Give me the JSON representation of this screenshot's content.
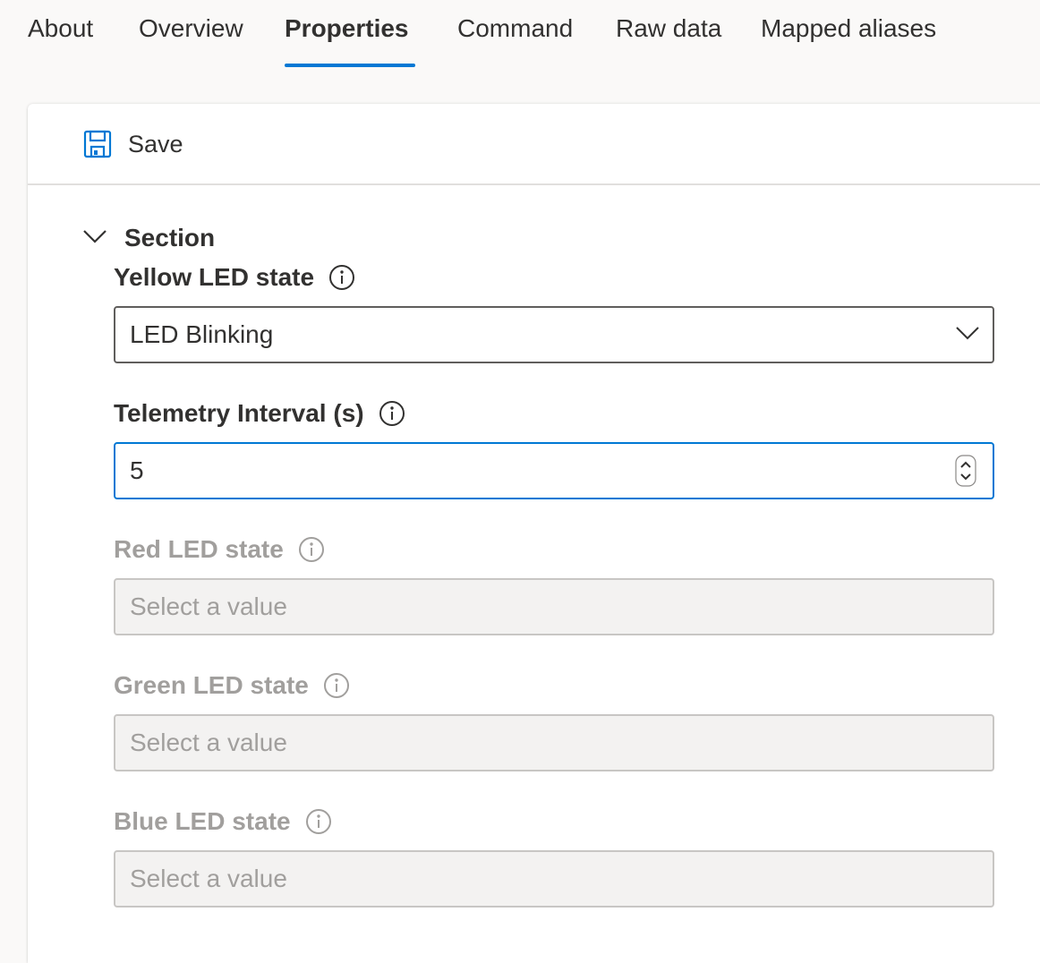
{
  "tabs": [
    {
      "label": "About",
      "active": false
    },
    {
      "label": "Overview",
      "active": false
    },
    {
      "label": "Properties",
      "active": true
    },
    {
      "label": "Command",
      "active": false
    },
    {
      "label": "Raw data",
      "active": false
    },
    {
      "label": "Mapped aliases",
      "active": false
    }
  ],
  "toolbar": {
    "save_label": "Save",
    "save_icon": "save-icon"
  },
  "section": {
    "title": "Section",
    "expanded": true,
    "fields": [
      {
        "label": "Yellow LED state",
        "type": "dropdown",
        "value": "LED Blinking",
        "disabled": false
      },
      {
        "label": "Telemetry Interval (s)",
        "type": "number",
        "value": "5",
        "disabled": false,
        "focused": true
      },
      {
        "label": "Red LED state",
        "type": "dropdown",
        "placeholder": "Select a value",
        "disabled": true
      },
      {
        "label": "Green LED state",
        "type": "dropdown",
        "placeholder": "Select a value",
        "disabled": true
      },
      {
        "label": "Blue LED state",
        "type": "dropdown",
        "placeholder": "Select a value",
        "disabled": true
      }
    ]
  },
  "colors": {
    "accent": "#0078d4",
    "text": "#323130",
    "disabled_text": "#a19f9d",
    "disabled_bg": "#f3f2f1"
  }
}
